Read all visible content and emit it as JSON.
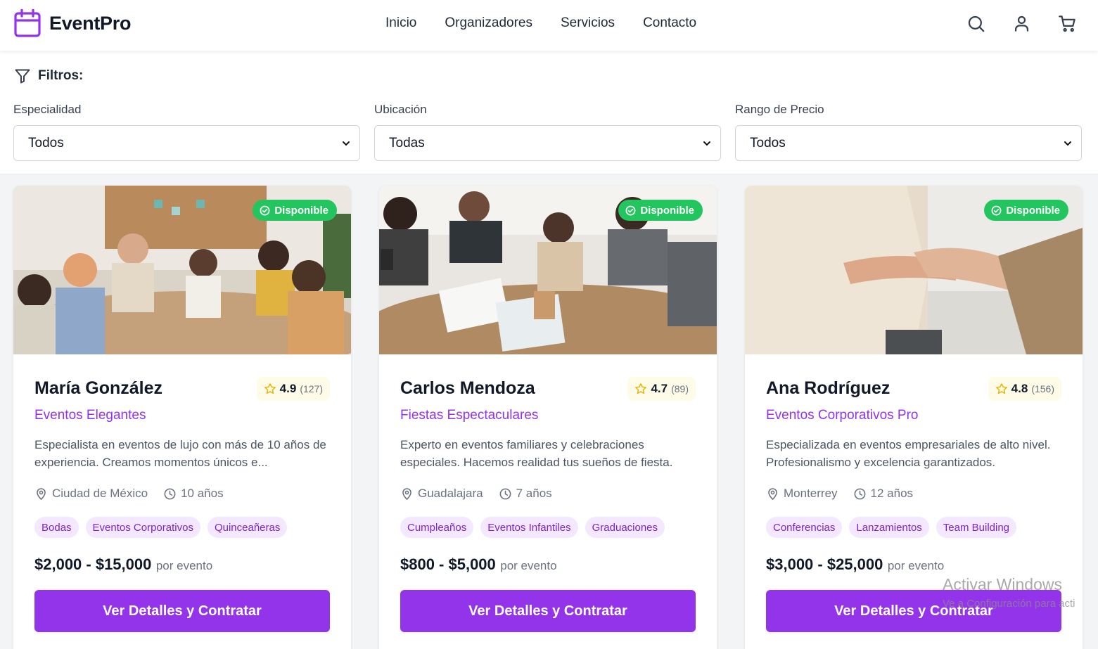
{
  "header": {
    "brand": "EventPro",
    "nav": [
      "Inicio",
      "Organizadores",
      "Servicios",
      "Contacto"
    ]
  },
  "filters": {
    "title": "Filtros:",
    "groups": [
      {
        "label": "Especialidad",
        "value": "Todos"
      },
      {
        "label": "Ubicación",
        "value": "Todas"
      },
      {
        "label": "Rango de Precio",
        "value": "Todos"
      }
    ]
  },
  "cards": [
    {
      "badge": "Disponible",
      "name": "María González",
      "rating": "4.9",
      "reviews": "(127)",
      "company": "Eventos Elegantes",
      "description": "Especialista en eventos de lujo con más de 10 años de experiencia. Creamos momentos únicos e...",
      "location": "Ciudad de México",
      "experience": "10 años",
      "tags": [
        "Bodas",
        "Eventos Corporativos",
        "Quinceañeras"
      ],
      "price": "$2,000 - $15,000",
      "price_unit": "por evento",
      "button": "Ver Detalles y Contratar"
    },
    {
      "badge": "Disponible",
      "name": "Carlos Mendoza",
      "rating": "4.7",
      "reviews": "(89)",
      "company": "Fiestas Espectaculares",
      "description": "Experto en eventos familiares y celebraciones especiales. Hacemos realidad tus sueños de fiesta.",
      "location": "Guadalajara",
      "experience": "7 años",
      "tags": [
        "Cumpleaños",
        "Eventos Infantiles",
        "Graduaciones"
      ],
      "price": "$800 - $5,000",
      "price_unit": "por evento",
      "button": "Ver Detalles y Contratar"
    },
    {
      "badge": "Disponible",
      "name": "Ana Rodríguez",
      "rating": "4.8",
      "reviews": "(156)",
      "company": "Eventos Corporativos Pro",
      "description": "Especializada en eventos empresariales de alto nivel. Profesionalismo y excelencia garantizados.",
      "location": "Monterrey",
      "experience": "12 años",
      "tags": [
        "Conferencias",
        "Lanzamientos",
        "Team Building"
      ],
      "price": "$3,000 - $25,000",
      "price_unit": "por evento",
      "button": "Ver Detalles y Contratar"
    }
  ],
  "watermark": {
    "title": "Activar Windows",
    "subtitle": "Ve a Configuración para acti"
  },
  "colors": {
    "accent": "#9333ea",
    "badge": "#22c55e",
    "tag_bg": "#f3e8ff"
  }
}
